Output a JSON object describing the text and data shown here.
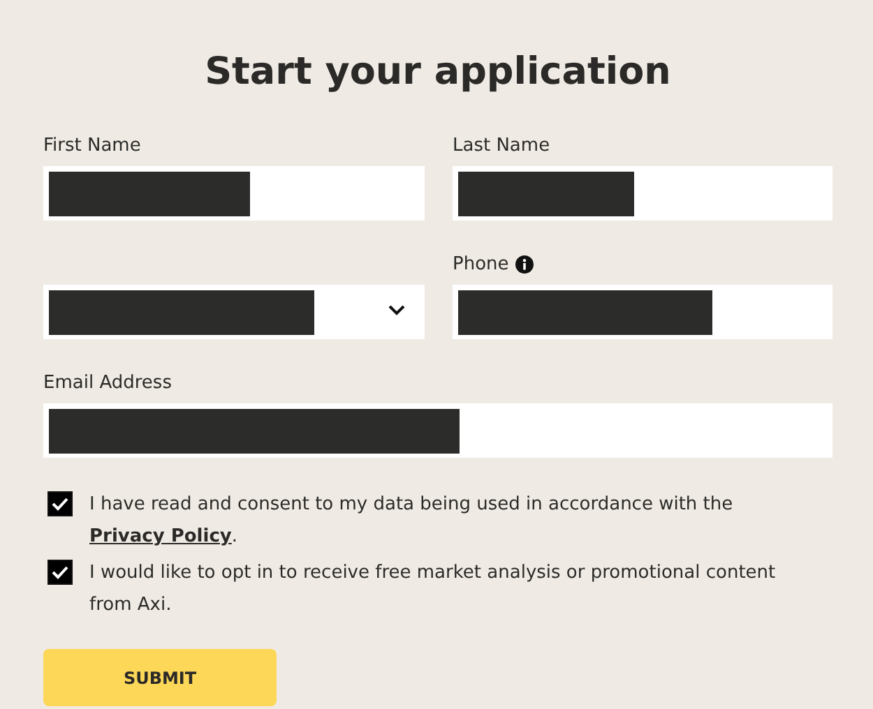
{
  "title": "Start your application",
  "fields": [
    {
      "label": "First Name",
      "kind": "text",
      "redacted": true
    },
    {
      "label": "Last Name",
      "kind": "text",
      "redacted": true
    },
    {
      "kind": "select",
      "redacted": true
    },
    {
      "label": "Phone",
      "kind": "text",
      "info": true,
      "redacted": true
    }
  ],
  "email_field": {
    "label": "Email Address",
    "kind": "text",
    "redacted": true
  },
  "checkboxes": [
    {
      "text": "I have read and consent to my data being used in accordance with the",
      "link": "Privacy Policy",
      "after": ".",
      "checked": true
    },
    {
      "text": "I would like to opt in to receive free market analysis or promotional content from Axi.",
      "checked": true
    }
  ],
  "submit": "SUBMIT"
}
